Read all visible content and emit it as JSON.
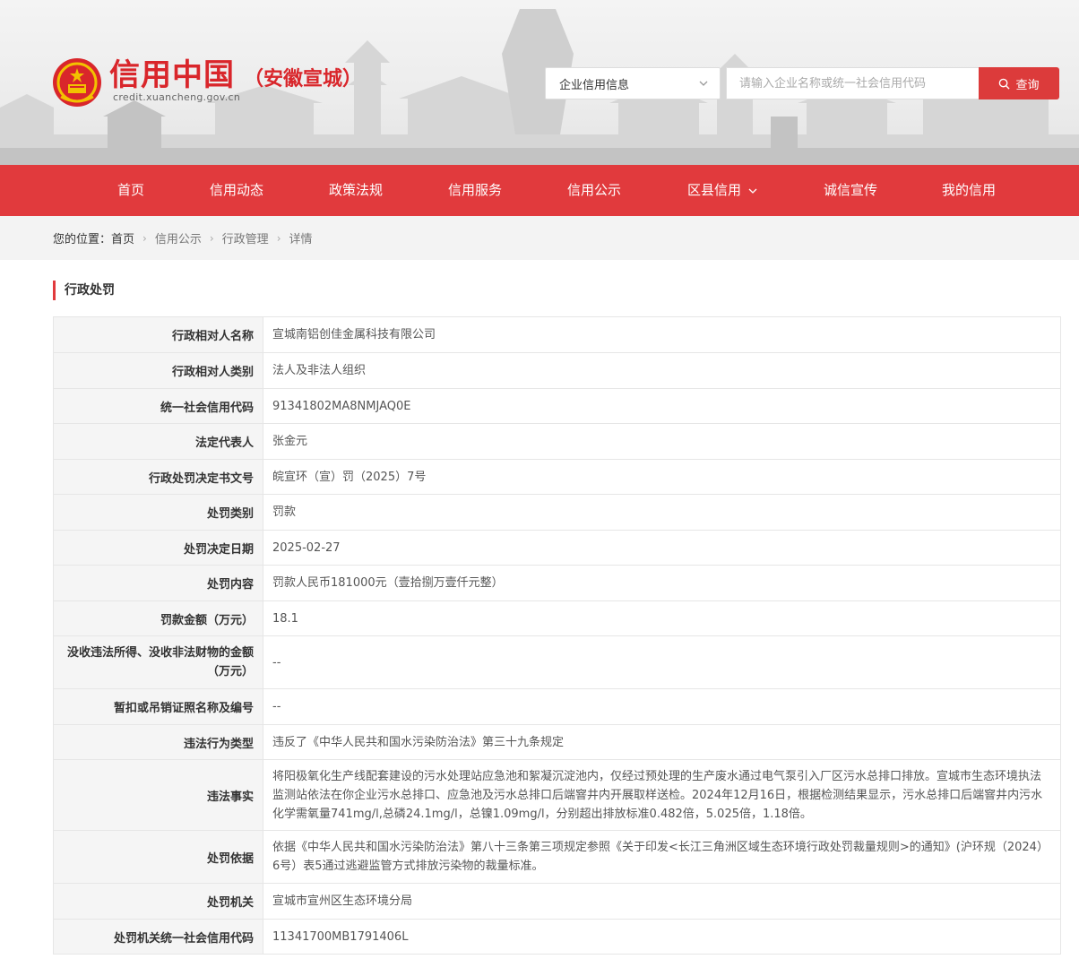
{
  "header": {
    "logo_title": "信用中国",
    "logo_region": "（安徽宣城）",
    "logo_url": "credit.xuancheng.gov.cn"
  },
  "search": {
    "category": "企业信用信息",
    "placeholder": "请输入企业名称或统一社会信用代码",
    "button_label": "查询"
  },
  "nav": {
    "items": [
      {
        "label": "首页"
      },
      {
        "label": "信用动态"
      },
      {
        "label": "政策法规"
      },
      {
        "label": "信用服务"
      },
      {
        "label": "信用公示"
      },
      {
        "label": "区县信用"
      },
      {
        "label": "诚信宣传"
      },
      {
        "label": "我的信用"
      }
    ]
  },
  "breadcrumb": {
    "label": "您的位置：",
    "home": "首页",
    "items": [
      "信用公示",
      "行政管理",
      "详情"
    ]
  },
  "section": {
    "title": "行政处罚"
  },
  "details": [
    {
      "key": "行政相对人名称",
      "value": "宣城南铝创佳金属科技有限公司"
    },
    {
      "key": "行政相对人类别",
      "value": "法人及非法人组织"
    },
    {
      "key": "统一社会信用代码",
      "value": "91341802MA8NMJAQ0E"
    },
    {
      "key": "法定代表人",
      "value": "张金元"
    },
    {
      "key": "行政处罚决定书文号",
      "value": "皖宣环（宣）罚（2025）7号"
    },
    {
      "key": "处罚类别",
      "value": "罚款"
    },
    {
      "key": "处罚决定日期",
      "value": "2025-02-27"
    },
    {
      "key": "处罚内容",
      "value": "罚款人民币181000元（壹拾捌万壹仟元整）"
    },
    {
      "key": "罚款金额（万元）",
      "value": "18.1"
    },
    {
      "key": "没收违法所得、没收非法财物的金额（万元）",
      "value": "--"
    },
    {
      "key": "暂扣或吊销证照名称及编号",
      "value": "--"
    },
    {
      "key": "违法行为类型",
      "value": "违反了《中华人民共和国水污染防治法》第三十九条规定"
    },
    {
      "key": "违法事实",
      "value": "将阳极氧化生产线配套建设的污水处理站应急池和絮凝沉淀池内，仅经过预处理的生产废水通过电气泵引入厂区污水总排口排放。宣城市生态环境执法监测站依法在你企业污水总排口、应急池及污水总排口后端窨井内开展取样送检。2024年12月16日，根据检测结果显示，污水总排口后端窨井内污水化学需氧量741mg/l,总磷24.1mg/l，总镍1.09mg/l，分别超出排放标准0.482倍，5.025倍，1.18倍。"
    },
    {
      "key": "处罚依据",
      "value": "依据《中华人民共和国水污染防治法》第八十三条第三项规定参照《关于印发<长江三角洲区域生态环境行政处罚裁量规则>的通知》(沪环规（2024）6号）表5通过逃避监管方式排放污染物的裁量标准。"
    },
    {
      "key": "处罚机关",
      "value": "宣城市宣州区生态环境分局"
    },
    {
      "key": "处罚机关统一社会信用代码",
      "value": "11341700MB1791406L"
    }
  ]
}
